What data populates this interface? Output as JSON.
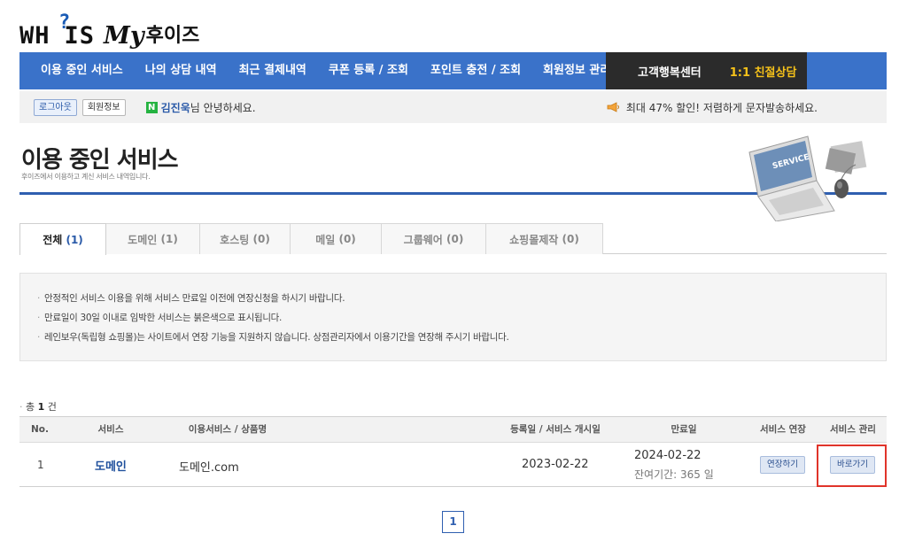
{
  "logo": {
    "whois": "WH?IS",
    "my": "My",
    "korean": "후이즈"
  },
  "nav": {
    "items": [
      "이용 중인 서비스",
      "나의 상담 내역",
      "최근 결제내역",
      "쿠폰 등록 / 조회",
      "포인트 충전 / 조회",
      "회원정보 관리"
    ],
    "customer_center": "고객행복센터",
    "consult": "1:1 친절상담"
  },
  "userbar": {
    "logout": "로그아웃",
    "member_info": "회원정보",
    "badge": "N",
    "user_name": "김진욱",
    "welcome": "님 안녕하세요.",
    "promo": "최대 47% 할인! 저렴하게 문자발송하세요."
  },
  "page": {
    "title": "이용 중인 서비스",
    "subtitle": "후이즈에서 이용하고 계신 서비스 내역입니다.",
    "image_label": "SERVICE"
  },
  "tabs": [
    {
      "label": "전체",
      "count": "(1)"
    },
    {
      "label": "도메인",
      "count": "(1)"
    },
    {
      "label": "호스팅",
      "count": "(0)"
    },
    {
      "label": "메일",
      "count": "(0)"
    },
    {
      "label": "그룹웨어",
      "count": "(0)"
    },
    {
      "label": "쇼핑몰제작",
      "count": "(0)"
    }
  ],
  "notice": [
    "안정적인 서비스 이용을 위해 서비스 만료일 이전에 연장신청을 하시기 바랍니다.",
    "만료일이 30일 이내로 임박한 서비스는 붉은색으로 표시됩니다.",
    "레인보우(독립형 쇼핑몰)는 사이트에서 연장 기능을 지원하지 않습니다. 상점관리자에서 이용기간을 연장해 주시기 바랍니다."
  ],
  "table": {
    "total_prefix": "총",
    "total_count": "1",
    "total_suffix": "건",
    "headers": [
      "No.",
      "서비스",
      "이용서비스 / 상품명",
      "등록일 / 서비스 개시일",
      "만료일",
      "서비스 연장",
      "서비스 관리"
    ],
    "rows": [
      {
        "no": "1",
        "service": "도메인",
        "product": "도메인.com",
        "registered": "2023-02-22",
        "expires": "2024-02-22",
        "remaining": "잔여기간: 365 일",
        "renew_button": "연장하기",
        "go_button": "바로가기"
      }
    ]
  },
  "pagination": {
    "current": "1"
  },
  "colors": {
    "nav_blue": "#3a72c9",
    "nav_dark": "#2b2b2b",
    "accent_yellow": "#f6c21a",
    "highlight_red": "#e0342a"
  }
}
